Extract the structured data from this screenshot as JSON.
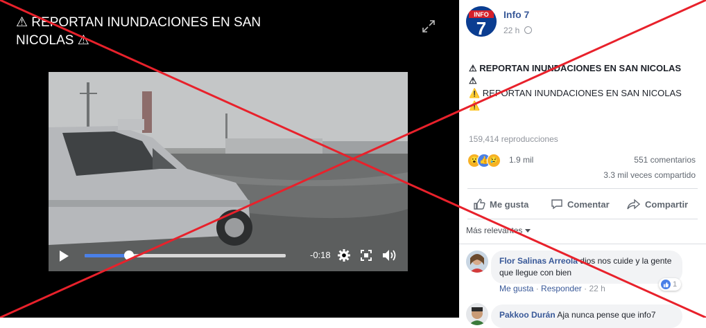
{
  "video": {
    "title": "⚠ REPORTAN INUNDACIONES EN SAN NICOLAS ⚠",
    "remaining_time": "-0:18",
    "progress_fraction": 0.22
  },
  "post": {
    "page_name": "Info 7",
    "logo_text": "INFO",
    "logo_number": "7",
    "time": "22 h",
    "title": "⚠ REPORTAN INUNDACIONES EN SAN NICOLAS ⚠",
    "body": "⚠️ REPORTAN INUNDACIONES EN SAN NICOLAS ⚠️",
    "views": "159,414 reproducciones",
    "reaction_count": "1.9 mil",
    "comments": "551 comentarios",
    "shares": "3.3 mil veces compartido"
  },
  "actions": {
    "like": "Me gusta",
    "comment": "Comentar",
    "share": "Compartir"
  },
  "sort_label": "Más relevantes",
  "comments": [
    {
      "author": "Flor Salinas Arreola",
      "text": "dios nos cuide y la gente que llegue con bien",
      "like": "Me gusta",
      "reply": "Responder",
      "time": "22 h",
      "likes": "1"
    },
    {
      "author": "Pakkoo Durán",
      "text": "Aja nunca pense que info7"
    }
  ],
  "colors": {
    "link": "#385898",
    "cross": "#e8212b",
    "progress": "#4a80e8"
  }
}
